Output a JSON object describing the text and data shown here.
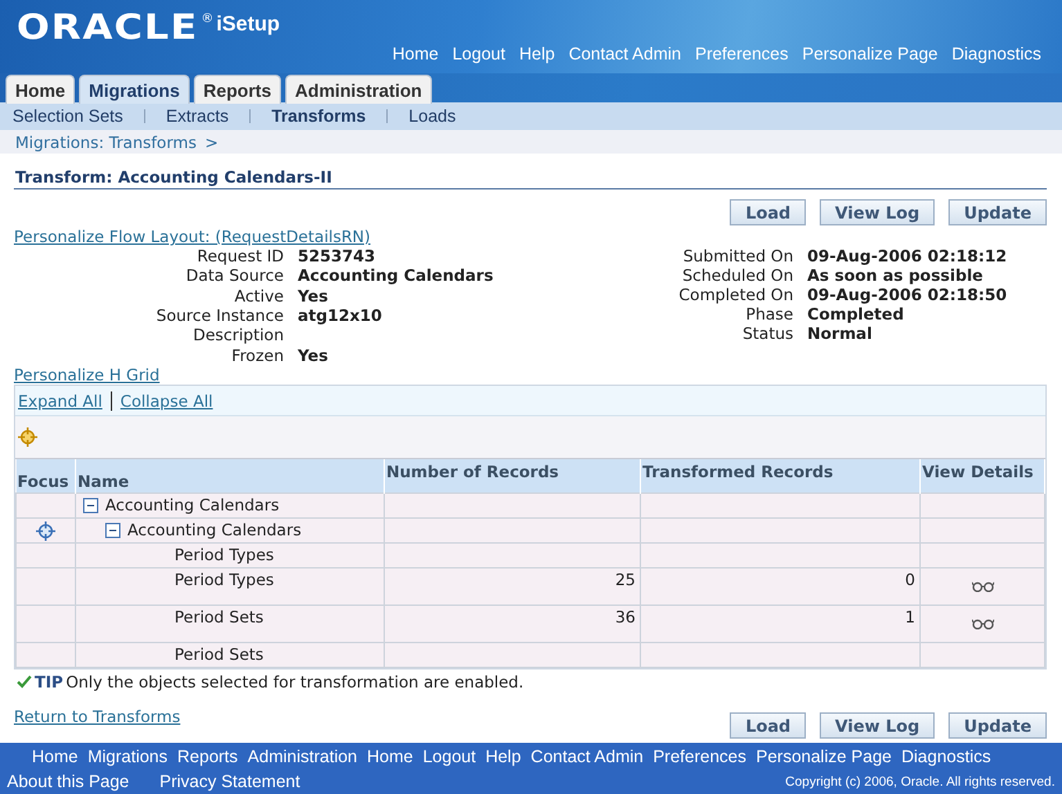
{
  "header": {
    "logo": "ORACLE",
    "logo_mark": "®",
    "product": "iSetup",
    "global_links": [
      "Home",
      "Logout",
      "Help",
      "Contact Admin",
      "Preferences",
      "Personalize Page",
      "Diagnostics"
    ]
  },
  "tabs": [
    {
      "label": "Home",
      "selected": false
    },
    {
      "label": "Migrations",
      "selected": true
    },
    {
      "label": "Reports",
      "selected": false
    },
    {
      "label": "Administration",
      "selected": false
    }
  ],
  "subtabs": [
    {
      "label": "Selection Sets",
      "selected": false
    },
    {
      "label": "Extracts",
      "selected": false
    },
    {
      "label": "Transforms",
      "selected": true
    },
    {
      "label": "Loads",
      "selected": false
    }
  ],
  "breadcrumb": [
    "Migrations: Transforms",
    ">"
  ],
  "page_title": "Transform: Accounting Calendars-II",
  "top_buttons": [
    "Load",
    "View Log",
    "Update"
  ],
  "personalize_flow_link": "Personalize Flow Layout: (RequestDetailsRN)",
  "details_left": [
    {
      "label": "Request ID",
      "value": "5253743"
    },
    {
      "label": "Data Source",
      "value": "Accounting Calendars"
    },
    {
      "label": "Active",
      "value": "Yes"
    },
    {
      "label": "Source Instance",
      "value": "atg12x10"
    },
    {
      "label": "Description"
    },
    {
      "label": "Frozen",
      "value": "Yes"
    }
  ],
  "details_right": [
    {
      "label": "Submitted On",
      "value": "09-Aug-2006 02:18:12"
    },
    {
      "label": "Scheduled On",
      "value": "As soon as possible"
    },
    {
      "label": "Completed On",
      "value": "09-Aug-2006 02:18:50"
    },
    {
      "label": "Phase",
      "value": "Completed"
    },
    {
      "label": "Status",
      "value": "Normal"
    }
  ],
  "personalize_grid_link": "Personalize H Grid",
  "grid": {
    "expand_all": "Expand All",
    "collapse_all": "Collapse All",
    "columns": [
      "Focus",
      "Name",
      "Number of Records",
      "Transformed Records",
      "View Details"
    ],
    "rows": [
      {
        "name": "Accounting Calendars",
        "expanded": true,
        "focusable": false,
        "details": false,
        "children": [
          {
            "name": "Accounting Calendars",
            "expanded": true,
            "focusable": true,
            "details": false,
            "children": [
              {
                "name": "Period Types",
                "focusable": false,
                "details": false
              },
              {
                "name": "Period Types",
                "records": "25",
                "transformed": "0",
                "focusable": false,
                "details": true
              },
              {
                "name": "Period Sets",
                "records": "36",
                "transformed": "1",
                "focusable": false,
                "details": true
              },
              {
                "name": "Period Sets",
                "focusable": false,
                "details": false
              }
            ]
          }
        ]
      }
    ]
  },
  "tip": {
    "label": "TIP",
    "text": "Only the objects selected for transformation are enabled."
  },
  "return_link": "Return to Transforms",
  "bottom_buttons": [
    "Load",
    "View Log",
    "Update"
  ],
  "footer": {
    "links": [
      "Home",
      "Migrations",
      "Reports",
      "Administration",
      "Home",
      "Logout",
      "Help",
      "Contact Admin",
      "Preferences",
      "Personalize Page",
      "Diagnostics"
    ],
    "about": "About this Page",
    "privacy": "Privacy Statement",
    "copyright": "Copyright (c) 2006, Oracle. All rights reserved."
  }
}
